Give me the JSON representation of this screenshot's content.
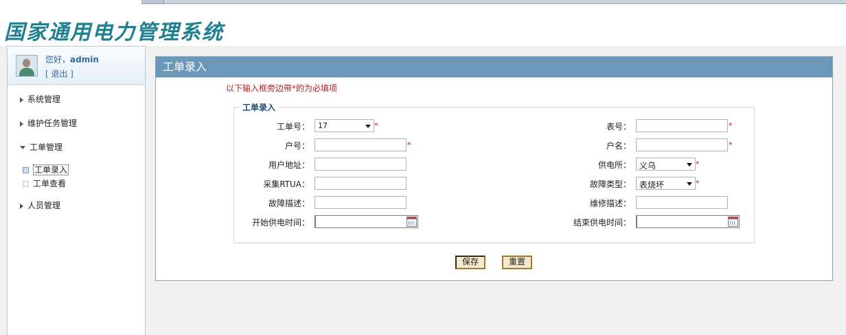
{
  "app": {
    "title": "国家通用电力管理系统"
  },
  "user": {
    "greeting": "您好，",
    "name": "admin",
    "logout": "[ 退出 ]"
  },
  "sidebar": {
    "items": [
      {
        "label": "系统管理"
      },
      {
        "label": "维护任务管理"
      },
      {
        "label": "工单管理"
      },
      {
        "label": "人员管理"
      }
    ],
    "subitems": [
      {
        "label": "工单录入"
      },
      {
        "label": "工单查看"
      }
    ]
  },
  "panel": {
    "title": "工单录入",
    "notice": "以下输入框旁边带*的为必填项",
    "legend": "工单录入"
  },
  "form": {
    "left": [
      {
        "label": "工单号：",
        "value": "17"
      },
      {
        "label": "户号：",
        "value": ""
      },
      {
        "label": "用户地址：",
        "value": ""
      },
      {
        "label": "采集RTUA：",
        "value": ""
      },
      {
        "label": "故障描述：",
        "value": ""
      },
      {
        "label": "开始供电时间：",
        "value": ""
      }
    ],
    "right": [
      {
        "label": "表号：",
        "value": ""
      },
      {
        "label": "户名：",
        "value": ""
      },
      {
        "label": "供电所：",
        "value": "义乌"
      },
      {
        "label": "故障类型：",
        "value": "表烧坏"
      },
      {
        "label": "维修描述：",
        "value": ""
      },
      {
        "label": "结束供电时间：",
        "value": ""
      }
    ],
    "required_mark": "*"
  },
  "buttons": {
    "save": "保存",
    "reset": "重置"
  },
  "icons": [
    "user-avatar-icon",
    "triangle-right-icon",
    "triangle-down-icon",
    "dropdown-arrow-icon",
    "calendar-icon"
  ]
}
